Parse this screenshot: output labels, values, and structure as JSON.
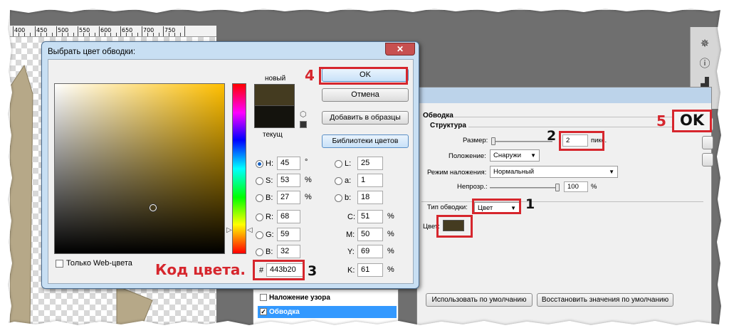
{
  "ruler": {
    "ticks": [
      "400",
      "450",
      "500",
      "550",
      "600",
      "650",
      "700",
      "750"
    ]
  },
  "side_icons": [
    "navigator-icon",
    "info-icon",
    "histogram-icon"
  ],
  "picker": {
    "title": "Выбрать цвет обводки:",
    "close_label": "✕",
    "label_new": "новый",
    "label_current": "текущ",
    "buttons": {
      "ok": "OK",
      "cancel": "Отмена",
      "add_swatches": "Добавить в образцы",
      "libraries": "Библиотеки цветов"
    },
    "web_only": "Только Web-цвета",
    "hsb": [
      {
        "key": "H:",
        "value": "45",
        "unit": "°",
        "checked": true
      },
      {
        "key": "S:",
        "value": "53",
        "unit": "%"
      },
      {
        "key": "B:",
        "value": "27",
        "unit": "%"
      }
    ],
    "rgb": [
      {
        "key": "R:",
        "value": "68"
      },
      {
        "key": "G:",
        "value": "59"
      },
      {
        "key": "B:",
        "value": "32"
      }
    ],
    "lab": [
      {
        "key": "L:",
        "value": "25"
      },
      {
        "key": "a:",
        "value": "1"
      },
      {
        "key": "b:",
        "value": "18"
      }
    ],
    "cmyk": [
      {
        "key": "C:",
        "value": "51",
        "unit": "%"
      },
      {
        "key": "M:",
        "value": "50",
        "unit": "%"
      },
      {
        "key": "Y:",
        "value": "69",
        "unit": "%"
      },
      {
        "key": "K:",
        "value": "61",
        "unit": "%"
      }
    ],
    "hex_label": "#",
    "hex_value": "443b20",
    "new_color": "#443b20",
    "current_color": "#14130d"
  },
  "layer_style": {
    "section": "Обводка",
    "subsection": "Структура",
    "size_label": "Размер:",
    "size_value": "2",
    "size_unit": "пикс.",
    "position_label": "Положение:",
    "position_value": "Снаружи",
    "blend_label": "Режим наложения:",
    "blend_value": "Нормальный",
    "opacity_label": "Непрозр.:",
    "opacity_value": "100",
    "opacity_unit": "%",
    "fill_type_label": "Тип обводки:",
    "fill_type_value": "Цвет",
    "color_label": "Цвет:",
    "stroke_color": "#443b20",
    "default_btn": "Использовать по умолчанию",
    "restore_btn": "Восстановить значения по умолчанию",
    "list": [
      {
        "label": "Наложение узора",
        "checked": false
      },
      {
        "label": "Обводка",
        "checked": true
      }
    ]
  },
  "annotations": {
    "n1": "1",
    "n2": "2",
    "n3": "3",
    "n4": "4",
    "n5": "5",
    "ok_big": "OK",
    "hex_caption": "Код цвета."
  }
}
